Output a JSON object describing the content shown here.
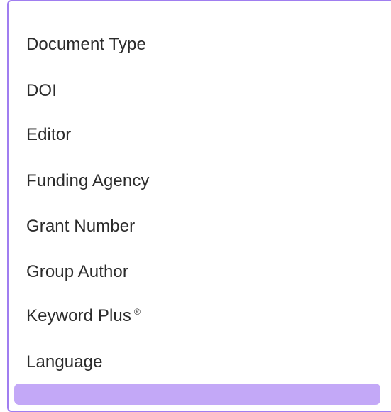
{
  "dropdown": {
    "options": [
      {
        "label": "Document Type"
      },
      {
        "label": "DOI"
      },
      {
        "label": "Editor"
      },
      {
        "label": "Funding Agency"
      },
      {
        "label": "Grant Number"
      },
      {
        "label": "Group Author"
      },
      {
        "label": "Keyword Plus",
        "suffix": "®"
      },
      {
        "label": "Language"
      },
      {
        "label": ""
      }
    ],
    "selected_index": 8,
    "colors": {
      "border": "#a07ef0",
      "selected_bg": "#c3a8f7",
      "text": "#2b2b2b"
    }
  }
}
